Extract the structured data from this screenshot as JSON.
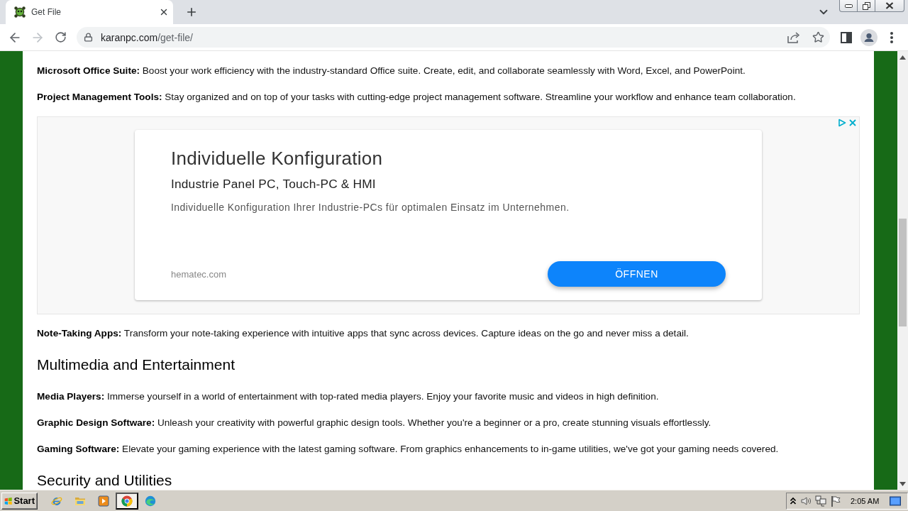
{
  "browser": {
    "tabs": [
      {
        "title": "Get File",
        "selected": true
      }
    ],
    "navigation": {
      "back": {
        "disabled": false
      },
      "forward": {
        "disabled": true
      }
    },
    "address": {
      "domain": "karanpc.com",
      "path": "/get-file/"
    }
  },
  "page": {
    "blocks": [
      {
        "kind": "paragraph",
        "text": "**Microsoft Office Suite:** Boost your work efficiency with the industry-standard Office suite. Create, edit, and collaborate seamlessly with Word, Excel, and PowerPoint."
      },
      {
        "kind": "paragraph",
        "text": "**Project Management Tools:** Stay organized and on top of your tasks with cutting-edge project management software. Streamline your workflow and enhance team collaboration."
      },
      {
        "kind": "ad",
        "headline": "Individuelle Konfiguration",
        "subheadline": "Industrie Panel PC, Touch-PC & HMI",
        "description": "Individuelle Konfiguration Ihrer Industrie-PCs für optimalen Einsatz im Unternehmen.",
        "domain": "hematec.com",
        "button": "ÖFFNEN"
      },
      {
        "kind": "paragraph",
        "text": "**Note-Taking Apps:** Transform your note-taking experience with intuitive apps that sync across devices. Capture ideas on the go and never miss a detail."
      },
      {
        "kind": "heading",
        "text": "Multimedia and Entertainment"
      },
      {
        "kind": "paragraph",
        "text": "**Media Players:** Immerse yourself in a world of entertainment with top-rated media players. Enjoy your favorite music and videos in high definition."
      },
      {
        "kind": "paragraph",
        "text": "**Graphic Design Software:** Unleash your creativity with powerful graphic design tools. Whether you're a beginner or a pro, create stunning visuals effortlessly."
      },
      {
        "kind": "paragraph",
        "text": "**Gaming Software:** Elevate your gaming experience with the latest gaming software. From graphics enhancements to in-game utilities, we've got your gaming needs covered."
      },
      {
        "kind": "heading",
        "text": "Security and Utilities"
      }
    ]
  },
  "taskbar": {
    "start": "Start",
    "apps": [
      {
        "kind": "ie",
        "selected": false
      },
      {
        "kind": "explorer",
        "selected": false
      },
      {
        "kind": "media",
        "selected": false
      },
      {
        "kind": "chrome",
        "selected": true
      },
      {
        "kind": "edge",
        "selected": false
      }
    ],
    "clock": "2:05 AM"
  }
}
